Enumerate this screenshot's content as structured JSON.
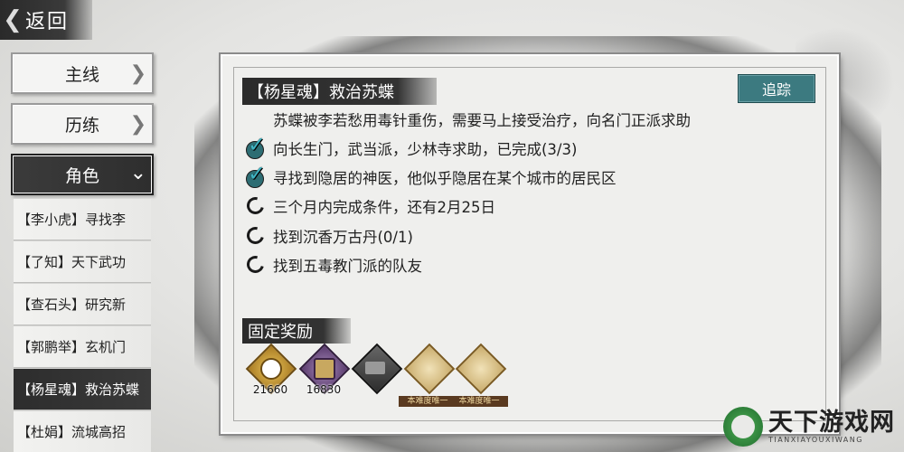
{
  "back": {
    "label": "返回"
  },
  "sidebar": {
    "tabs": [
      {
        "label": "主线"
      },
      {
        "label": "历练"
      },
      {
        "label": "角色"
      }
    ],
    "quests": [
      {
        "label": "【李小虎】寻找李"
      },
      {
        "label": "【了知】天下武功"
      },
      {
        "label": "【查石头】研究新"
      },
      {
        "label": "【郭鹏举】玄机门"
      },
      {
        "label": "【杨星魂】救治苏蝶"
      },
      {
        "label": "【杜娟】流城高招"
      }
    ]
  },
  "quest": {
    "title": "【杨星魂】救治苏蝶",
    "track_label": "追踪",
    "description": "苏蝶被李若愁用毒针重伤，需要马上接受治疗，向名门正派求助",
    "tasks": [
      {
        "text": "向长生门，武当派，少林寺求助，已完成(3/3)",
        "done": true
      },
      {
        "text": "寻找到隐居的神医，他似乎隐居在某个城市的居民区",
        "done": true
      },
      {
        "text": "三个月内完成条件，还有2月25日",
        "done": false
      },
      {
        "text": "找到沉香万古丹(0/1)",
        "done": false
      },
      {
        "text": "找到五毒教门派的队友",
        "done": false
      }
    ]
  },
  "rewards": {
    "title": "固定奖励",
    "items": [
      {
        "icon": "gold-coin-icon",
        "count": "21660"
      },
      {
        "icon": "purple-coin-icon",
        "count": "16830"
      },
      {
        "icon": "chest-icon",
        "count": ""
      },
      {
        "icon": "scroll-icon",
        "count": "",
        "tag": "本难度唯一"
      },
      {
        "icon": "scroll-icon",
        "count": "",
        "tag": "本难度唯一"
      }
    ]
  },
  "watermark": {
    "cn": "天下游戏网",
    "en": "TIANXIAYOUXIWANG"
  }
}
